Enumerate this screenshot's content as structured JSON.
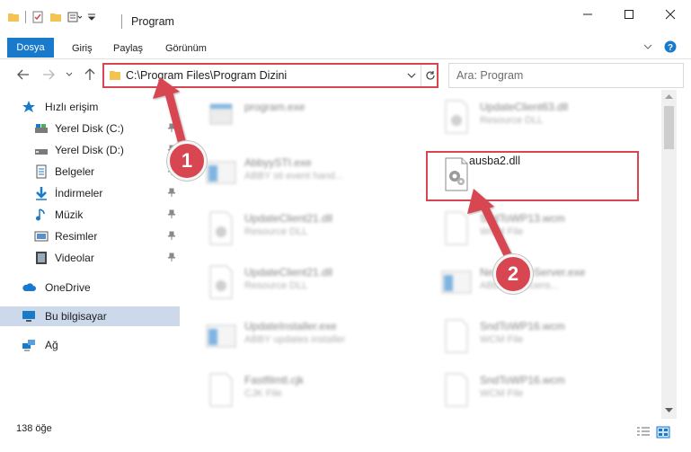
{
  "window": {
    "title": "Program",
    "controls": {
      "minimize": "minimize-icon",
      "maximize": "maximize-icon",
      "close": "close-icon"
    }
  },
  "ribbon": {
    "tabs": [
      "Dosya",
      "Giriş",
      "Paylaş",
      "Görünüm"
    ]
  },
  "address": {
    "path": "C:\\Program Files\\Program Dizini"
  },
  "search": {
    "placeholder": "Ara: Program"
  },
  "sidebar": {
    "quick_access": "Hızlı erişim",
    "items": [
      {
        "label": "Yerel Disk (C:)",
        "icon": "drive-icon",
        "pinned": true
      },
      {
        "label": "Yerel Disk (D:)",
        "icon": "drive-icon",
        "pinned": true
      },
      {
        "label": "Belgeler",
        "icon": "documents-icon",
        "pinned": true
      },
      {
        "label": "İndirmeler",
        "icon": "downloads-icon",
        "pinned": true
      },
      {
        "label": "Müzik",
        "icon": "music-icon",
        "pinned": true
      },
      {
        "label": "Resimler",
        "icon": "pictures-icon",
        "pinned": true
      },
      {
        "label": "Videolar",
        "icon": "videos-icon",
        "pinned": true
      }
    ],
    "onedrive": "OneDrive",
    "this_pc": "Bu bilgisayar",
    "network": "Ağ"
  },
  "files": [
    {
      "name": "program.exe",
      "type": ""
    },
    {
      "name": "UpdateClient63.dll",
      "type": "Resource DLL"
    },
    {
      "name": "AbbyySTI.exe",
      "type": "ABBY sti event hand..."
    },
    {
      "name": "ausba2.dll",
      "type": ""
    },
    {
      "name": "UpdateClient21.dll",
      "type": "Resource DLL"
    },
    {
      "name": "SndToWP13.wcm",
      "type": "WCM File"
    },
    {
      "name": "UpdateClient21.dll",
      "type": "Resource DLL"
    },
    {
      "name": "NetLicenseServer.exe",
      "type": "ABBY net licens..."
    },
    {
      "name": "UpdateInstaller.exe",
      "type": "ABBY updates installer"
    },
    {
      "name": "SndToWP16.wcm",
      "type": "WCM File"
    },
    {
      "name": "Fastfilmtl.cjk",
      "type": "CJK File"
    },
    {
      "name": "SndToWP16.wcm",
      "type": "WCM File"
    }
  ],
  "status": {
    "count": "138 öğe"
  },
  "callouts": [
    "1",
    "2"
  ],
  "colors": {
    "accent": "#1979ca",
    "highlight": "#d84651",
    "selected": "#ccd9eb"
  }
}
